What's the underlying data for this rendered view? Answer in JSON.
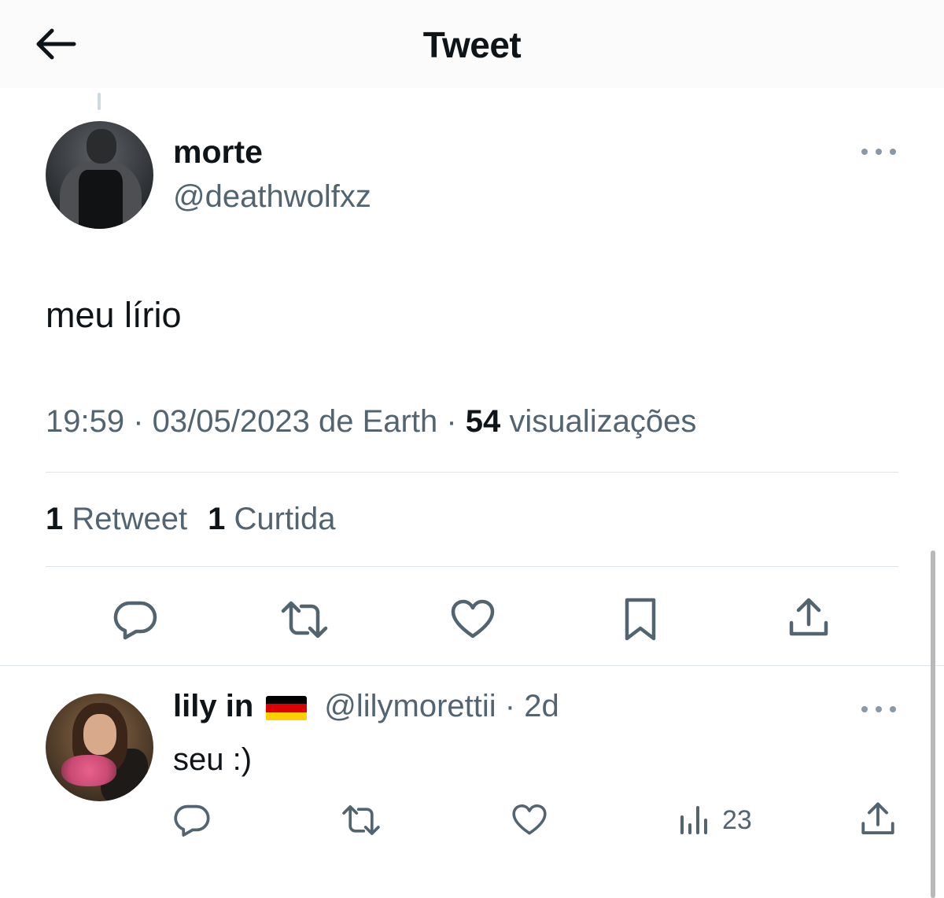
{
  "header": {
    "title": "Tweet",
    "back_icon": "arrow-left-icon"
  },
  "tweet": {
    "author_name": "morte",
    "author_handle": "@deathwolfxz",
    "text": "meu lírio",
    "time": "19:59",
    "date": "03/05/2023",
    "source_prefix": "de",
    "source": "Earth",
    "views_count": "54",
    "views_label": "visualizações",
    "retweets_count": "1",
    "retweets_label": "Retweet",
    "likes_count": "1",
    "likes_label": "Curtida",
    "actions": [
      "reply-icon",
      "retweet-icon",
      "like-icon",
      "bookmark-icon",
      "share-icon"
    ]
  },
  "reply": {
    "author_name": "lily in",
    "flag": "germany-flag-icon",
    "author_handle": "@lilymorettii",
    "age": "2d",
    "text": "seu :)",
    "views_count": "23",
    "actions": [
      "reply-icon",
      "retweet-icon",
      "like-icon",
      "views-icon",
      "share-icon"
    ]
  },
  "colors": {
    "primary_text": "#0f1419",
    "secondary_text": "#536471",
    "divider": "#dfe4e8",
    "icon": "#536471"
  }
}
